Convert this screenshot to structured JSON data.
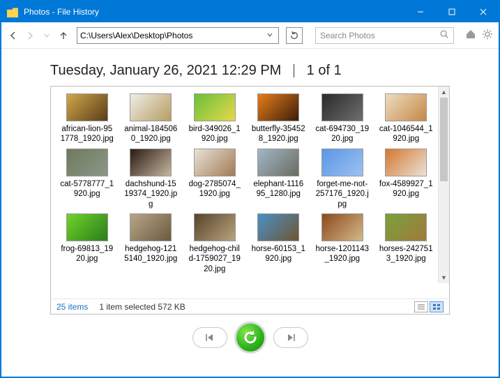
{
  "window": {
    "title": "Photos - File History"
  },
  "path": "C:\\Users\\Alex\\Desktop\\Photos",
  "search": {
    "placeholder": "Search Photos"
  },
  "heading": {
    "timestamp": "Tuesday, January 26, 2021 12:29 PM",
    "pager": "1 of 1"
  },
  "files": [
    {
      "name": "african-lion-951778_1920.jpg",
      "colors": [
        "#d0a84a",
        "#5a3d1a"
      ]
    },
    {
      "name": "animal-1845060_1920.jpg",
      "colors": [
        "#efede6",
        "#b69d62"
      ]
    },
    {
      "name": "bird-349026_1920.jpg",
      "colors": [
        "#6abf3b",
        "#e6d94a"
      ]
    },
    {
      "name": "butterfly-354528_1920.jpg",
      "colors": [
        "#e77e1a",
        "#3c1d0b"
      ]
    },
    {
      "name": "cat-694730_1920.jpg",
      "colors": [
        "#2a2a2a",
        "#6e6e6e"
      ]
    },
    {
      "name": "cat-1046544_1920.jpg",
      "colors": [
        "#eedcc2",
        "#c58845"
      ]
    },
    {
      "name": "cat-5778777_1920.jpg",
      "colors": [
        "#6e7a5a",
        "#8c978a"
      ]
    },
    {
      "name": "dachshund-1519374_1920.jpg",
      "colors": [
        "#2b1a12",
        "#c7b7a0"
      ]
    },
    {
      "name": "dog-2785074_1920.jpg",
      "colors": [
        "#e9e2d7",
        "#a27a54"
      ]
    },
    {
      "name": "elephant-111695_1280.jpg",
      "colors": [
        "#a2b7c7",
        "#6b6b60"
      ]
    },
    {
      "name": "forget-me-not-257176_1920.jpg",
      "colors": [
        "#5a96e6",
        "#9dc1f0"
      ]
    },
    {
      "name": "fox-4589927_1920.jpg",
      "colors": [
        "#d6772e",
        "#e9e2d8"
      ]
    },
    {
      "name": "frog-69813_1920.jpg",
      "colors": [
        "#6fd42a",
        "#2c7c1a"
      ]
    },
    {
      "name": "hedgehog-1215140_1920.jpg",
      "colors": [
        "#b7a68a",
        "#6c5a3e"
      ]
    },
    {
      "name": "hedgehog-child-1759027_1920.jpg",
      "colors": [
        "#56432b",
        "#b9a37e"
      ]
    },
    {
      "name": "horse-60153_1920.jpg",
      "colors": [
        "#4a90c8",
        "#6e5630"
      ]
    },
    {
      "name": "horse-1201143_1920.jpg",
      "colors": [
        "#8a4a1c",
        "#d4b98a"
      ]
    },
    {
      "name": "horses-2427513_1920.jpg",
      "colors": [
        "#7aa03c",
        "#a07a3c"
      ]
    }
  ],
  "status": {
    "count": "25 items",
    "selection": "1 item selected  572 KB"
  }
}
